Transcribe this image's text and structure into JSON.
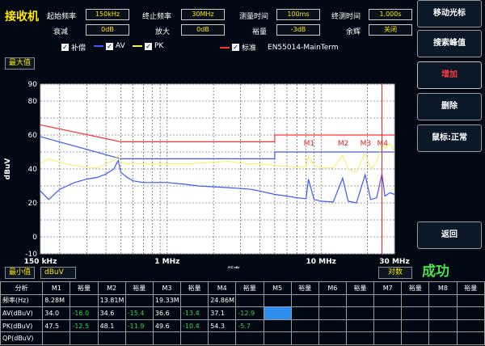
{
  "app": {
    "title": "接收机"
  },
  "params": [
    {
      "label": "起始频率",
      "value": "150kHz"
    },
    {
      "label": "终止频率",
      "value": "30MHz"
    },
    {
      "label": "测量时间",
      "value": "100ms"
    },
    {
      "label": "终测时间",
      "value": "1.000s"
    },
    {
      "label": "衰减",
      "value": "0dB"
    },
    {
      "label": "放大",
      "value": "0dB"
    },
    {
      "label": "裕量",
      "value": "-3dB"
    },
    {
      "label": "余辉",
      "value": "关闭"
    }
  ],
  "legend": {
    "correction": "补偿",
    "av": "AV",
    "pk": "PK",
    "standard": "标准",
    "standard_name": "EN55014-MainTerm",
    "check": "✓"
  },
  "scale": {
    "max_label": "最大值",
    "min_label": "最小值",
    "unit": "dBuV",
    "scale_type": "对数"
  },
  "chart_data": {
    "type": "line",
    "ylabel": "dBuV",
    "xlabel": "频率",
    "x_scale": "log",
    "xlim_mhz": [
      0.15,
      30
    ],
    "ylim": [
      -10,
      90
    ],
    "yticks": [
      "90",
      "80",
      "60",
      "40",
      "20",
      "0",
      "-10"
    ],
    "xticks": [
      "150 kHz",
      "1 MHz",
      "10 MHz",
      "30 MHz"
    ],
    "colors": {
      "pk": "#f2ef55",
      "av": "#3b57ff",
      "limit": "#ff3030",
      "marker": "#e02020",
      "bg": "#ffffff"
    },
    "limit_qp": {
      "x": [
        0.15,
        0.5,
        0.5,
        5,
        5,
        30
      ],
      "y": [
        66,
        56,
        56,
        56,
        60,
        60
      ]
    },
    "limit_av": {
      "x": [
        0.15,
        0.5,
        0.5,
        5,
        5,
        30
      ],
      "y": [
        59,
        46,
        46,
        46,
        50,
        50
      ]
    },
    "pk": {
      "x": [
        0.15,
        0.17,
        0.2,
        0.25,
        0.3,
        0.35,
        0.4,
        0.45,
        0.48,
        0.5,
        0.55,
        0.6,
        0.7,
        0.8,
        1.0,
        1.3,
        1.6,
        2.0,
        2.5,
        3.0,
        3.5,
        4.0,
        5.0,
        6.0,
        7.0,
        8.0,
        8.28,
        9.0,
        10,
        12,
        13.81,
        15,
        17,
        19.33,
        21,
        23,
        24.86,
        26,
        28,
        30
      ],
      "y": [
        43,
        46,
        44,
        42,
        41,
        40.5,
        43,
        45,
        48,
        44,
        43,
        43.5,
        43,
        43,
        43,
        43,
        43.5,
        44,
        44.5,
        43.5,
        43,
        43,
        42,
        41.5,
        41,
        41.5,
        47.5,
        42,
        41,
        40.5,
        48.1,
        40,
        38,
        49.6,
        40,
        44,
        54.3,
        52,
        55,
        50
      ]
    },
    "av": {
      "x": [
        0.15,
        0.17,
        0.2,
        0.25,
        0.3,
        0.35,
        0.4,
        0.45,
        0.48,
        0.5,
        0.55,
        0.6,
        0.7,
        0.8,
        1.0,
        1.3,
        1.6,
        2.0,
        2.5,
        3.0,
        3.5,
        4.0,
        5.0,
        6.0,
        7.0,
        8.0,
        8.28,
        9.0,
        10,
        12,
        13.81,
        15,
        17,
        19.33,
        21,
        23,
        24.86,
        26,
        28,
        30
      ],
      "y": [
        27,
        22,
        28,
        32,
        34,
        35,
        37,
        40,
        45,
        38,
        35,
        33,
        32,
        32,
        32,
        31,
        30,
        29.5,
        29,
        28.5,
        28,
        27,
        25,
        24,
        23,
        22.5,
        34.0,
        22,
        21,
        20.5,
        34.6,
        21,
        20,
        36.6,
        22,
        23,
        37.1,
        24,
        26,
        25
      ]
    },
    "markers": [
      {
        "name": "M1",
        "x": 8.28
      },
      {
        "name": "M2",
        "x": 13.81
      },
      {
        "name": "M3",
        "x": 19.33
      },
      {
        "name": "M4",
        "x": 24.86
      }
    ]
  },
  "side": {
    "move_cursor": "移动光标",
    "search_peak": "搜索峰值",
    "add": "增加",
    "delete": "删除",
    "cursor_normal": "鼠标:正常",
    "back": "返回",
    "status": "成功"
  },
  "table": {
    "header": [
      "分析",
      "M1",
      "裕量",
      "M2",
      "裕量",
      "M3",
      "裕量",
      "M4",
      "裕量",
      "M5",
      "裕量",
      "M6",
      "裕量",
      "M7",
      "裕量",
      "M8",
      "裕量"
    ],
    "rows": [
      [
        "频率(Hz)",
        "8.28M",
        "",
        "13.81M",
        "",
        "19.33M",
        "",
        "24.86M",
        "",
        "",
        "",
        "",
        "",
        "",
        "",
        "",
        ""
      ],
      [
        "AV(dBuV)",
        "34.0",
        "-16.0",
        "34.6",
        "-15.4",
        "36.6",
        "-13.4",
        "37.1",
        "-12.9",
        "",
        "",
        "",
        "",
        "",
        "",
        "",
        ""
      ],
      [
        "PK(dBuV)",
        "47.5",
        "-12.5",
        "48.1",
        "-11.9",
        "49.6",
        "-10.4",
        "54.3",
        "-5.7",
        "",
        "",
        "",
        "",
        "",
        "",
        "",
        ""
      ],
      [
        "QP(dBuV)",
        "",
        "",
        "",
        "",
        "",
        "",
        "",
        "",
        "",
        "",
        "",
        "",
        "",
        "",
        "",
        ""
      ]
    ]
  }
}
